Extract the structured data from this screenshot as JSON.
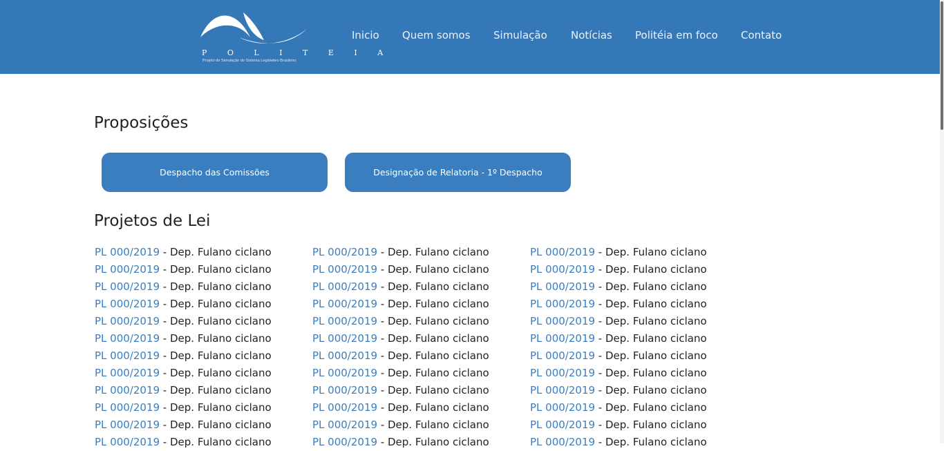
{
  "colors": {
    "header": "#3578b7",
    "button": "#3a7ebf",
    "link": "#3a7ebf"
  },
  "brand": {
    "name": "P O L I T E I A",
    "tagline": "Projeto de Simulação do Sistema Legislativo Brasileiro"
  },
  "nav": {
    "items": [
      "Inicio",
      "Quem somos",
      "Simulação",
      "Notícias",
      "Politéia em foco",
      "Contato"
    ]
  },
  "proposicoes": {
    "heading": "Proposições",
    "buttons": [
      "Despacho das Comissões",
      "Designação de Relatoria - 1º Despacho"
    ]
  },
  "projetos": {
    "heading": "Projetos de Lei",
    "separator": " - ",
    "columns": [
      [
        {
          "code": "PL 000/2019",
          "author": "Dep. Fulano ciclano"
        },
        {
          "code": "PL 000/2019",
          "author": "Dep. Fulano ciclano"
        },
        {
          "code": "PL 000/2019",
          "author": "Dep. Fulano ciclano"
        },
        {
          "code": "PL 000/2019",
          "author": "Dep. Fulano ciclano"
        },
        {
          "code": "PL 000/2019",
          "author": "Dep. Fulano ciclano"
        },
        {
          "code": "PL 000/2019",
          "author": "Dep. Fulano ciclano"
        },
        {
          "code": "PL 000/2019",
          "author": "Dep. Fulano ciclano"
        },
        {
          "code": "PL 000/2019",
          "author": "Dep. Fulano ciclano"
        },
        {
          "code": "PL 000/2019",
          "author": "Dep. Fulano ciclano"
        },
        {
          "code": "PL 000/2019",
          "author": "Dep. Fulano ciclano"
        },
        {
          "code": "PL 000/2019",
          "author": "Dep. Fulano ciclano"
        },
        {
          "code": "PL 000/2019",
          "author": "Dep. Fulano ciclano"
        }
      ],
      [
        {
          "code": "PL 000/2019",
          "author": "Dep. Fulano ciclano"
        },
        {
          "code": "PL 000/2019",
          "author": "Dep. Fulano ciclano"
        },
        {
          "code": "PL 000/2019",
          "author": "Dep. Fulano ciclano"
        },
        {
          "code": "PL 000/2019",
          "author": "Dep. Fulano ciclano"
        },
        {
          "code": "PL 000/2019",
          "author": "Dep. Fulano ciclano"
        },
        {
          "code": "PL 000/2019",
          "author": "Dep. Fulano ciclano"
        },
        {
          "code": "PL 000/2019",
          "author": "Dep. Fulano ciclano"
        },
        {
          "code": "PL 000/2019",
          "author": "Dep. Fulano ciclano"
        },
        {
          "code": "PL 000/2019",
          "author": "Dep. Fulano ciclano"
        },
        {
          "code": "PL 000/2019",
          "author": "Dep. Fulano ciclano"
        },
        {
          "code": "PL 000/2019",
          "author": "Dep. Fulano ciclano"
        },
        {
          "code": "PL 000/2019",
          "author": "Dep. Fulano ciclano"
        }
      ],
      [
        {
          "code": "PL 000/2019",
          "author": "Dep. Fulano ciclano"
        },
        {
          "code": "PL 000/2019",
          "author": "Dep. Fulano ciclano"
        },
        {
          "code": "PL 000/2019",
          "author": "Dep. Fulano ciclano"
        },
        {
          "code": "PL 000/2019",
          "author": "Dep. Fulano ciclano"
        },
        {
          "code": "PL 000/2019",
          "author": "Dep. Fulano ciclano"
        },
        {
          "code": "PL 000/2019",
          "author": "Dep. Fulano ciclano"
        },
        {
          "code": "PL 000/2019",
          "author": "Dep. Fulano ciclano"
        },
        {
          "code": "PL 000/2019",
          "author": "Dep. Fulano ciclano"
        },
        {
          "code": "PL 000/2019",
          "author": "Dep. Fulano ciclano"
        },
        {
          "code": "PL 000/2019",
          "author": "Dep. Fulano ciclano"
        },
        {
          "code": "PL 000/2019",
          "author": "Dep. Fulano ciclano"
        },
        {
          "code": "PL 000/2019",
          "author": "Dep. Fulano ciclano"
        }
      ]
    ]
  }
}
